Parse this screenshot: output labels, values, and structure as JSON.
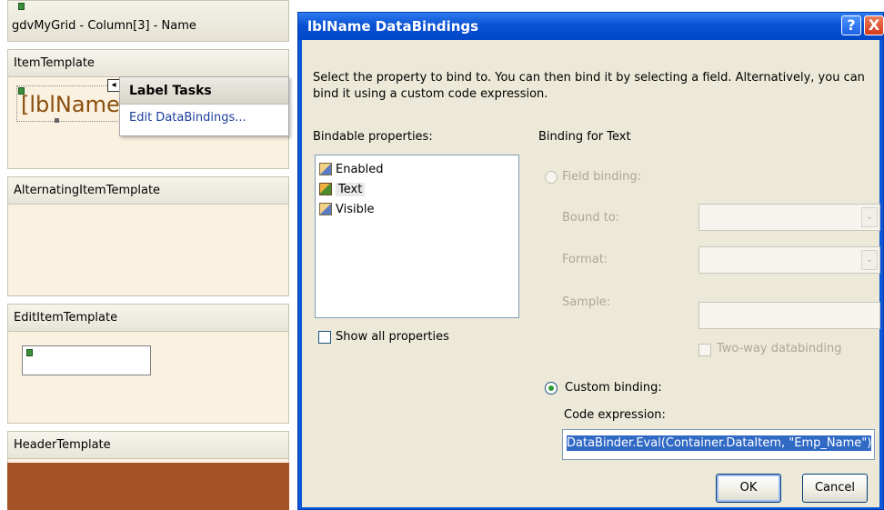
{
  "designer": {
    "title": "gdvMyGrid - Column[3] - Name",
    "templates": {
      "item": "ItemTemplate",
      "alternating": "AlternatingItemTemplate",
      "edit": "EditItemTemplate",
      "header": "HeaderTemplate"
    },
    "label_control": "[lblName",
    "smart_tag_chevron": "◂",
    "label_tasks": {
      "header": "Label Tasks",
      "link": "Edit DataBindings..."
    },
    "header_band_color": "#a55226"
  },
  "dialog": {
    "title": "lblName DataBindings",
    "help_glyph": "?",
    "close_glyph": "X",
    "instruction": "Select the property to bind to. You can then bind it by selecting a field. Alternatively, you can bind it using a custom code expression.",
    "bindable_label": "Bindable properties:",
    "properties": [
      {
        "label": "Enabled",
        "icon": "property-icon",
        "selected": false
      },
      {
        "label": "Text",
        "icon": "text-property-icon",
        "selected": true
      },
      {
        "label": "Visible",
        "icon": "property-icon",
        "selected": false
      }
    ],
    "show_all_label": "Show all properties",
    "binding_for_label": "Binding for Text",
    "field_binding_label": "Field binding:",
    "bound_to_label": "Bound to:",
    "format_label": "Format:",
    "sample_label": "Sample:",
    "two_way_label": "Two-way databinding",
    "custom_binding_label": "Custom binding:",
    "code_expression_label": "Code expression:",
    "code_expression_value": "DataBinder.Eval(Container.DataItem, \"Emp_Name\")",
    "ok_label": "OK",
    "cancel_label": "Cancel",
    "combo_arrow": "⌄"
  }
}
